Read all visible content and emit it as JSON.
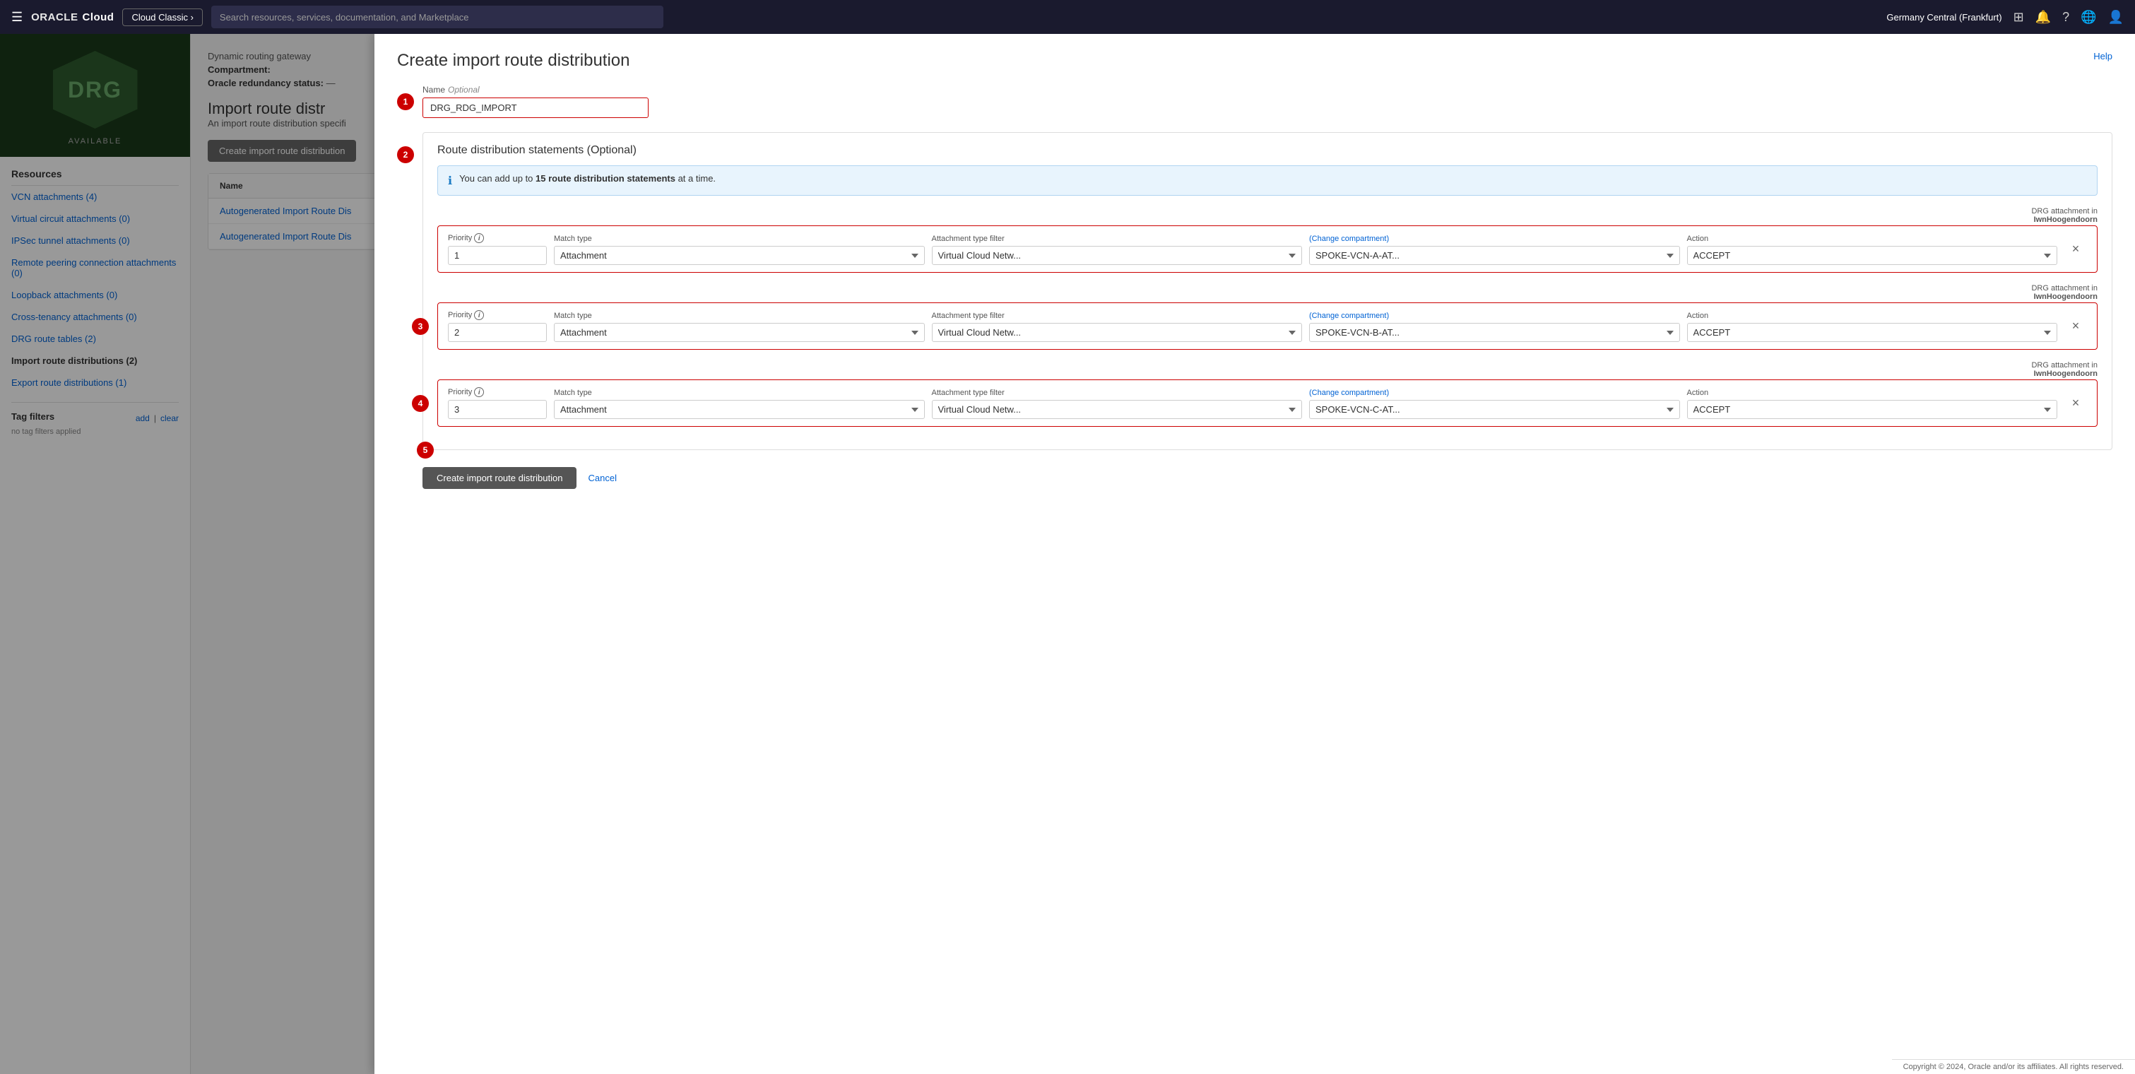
{
  "topNav": {
    "hamburger": "☰",
    "logoOracle": "ORACLE",
    "logoCloud": "Cloud",
    "cloudClassicLabel": "Cloud Classic ›",
    "searchPlaceholder": "Search resources, services, documentation, and Marketplace",
    "region": "Germany Central (Frankfurt)",
    "icons": {
      "console": "⊞",
      "bell": "🔔",
      "help": "?",
      "globe": "🌐",
      "user": "👤"
    }
  },
  "sidebar": {
    "drgText": "DRG",
    "availableLabel": "AVAILABLE",
    "resourcesTitle": "Resources",
    "items": [
      {
        "label": "VCN attachments (4)",
        "active": false
      },
      {
        "label": "Virtual circuit attachments (0)",
        "active": false
      },
      {
        "label": "IPSec tunnel attachments (0)",
        "active": false
      },
      {
        "label": "Remote peering connection attachments (0)",
        "active": false
      },
      {
        "label": "Loopback attachments (0)",
        "active": false
      },
      {
        "label": "Cross-tenancy attachments (0)",
        "active": false
      },
      {
        "label": "DRG route tables (2)",
        "active": false
      },
      {
        "label": "Import route distributions (2)",
        "active": true
      },
      {
        "label": "Export route distributions (1)",
        "active": false
      }
    ],
    "tagFiltersTitle": "Tag filters",
    "tagAddLabel": "add",
    "tagClearLabel": "clear",
    "noTagsLabel": "no tag filters applied"
  },
  "mainContent": {
    "pageHeaderLabel": "Dynamic routing gateway",
    "compartmentLabel": "Compartment:",
    "compartmentValue": "",
    "redundancyLabel": "Oracle redundancy status:",
    "redundancyValue": "—",
    "pageTitlePrefix": "Import route distr",
    "pageSubtitle": "An import route distribution specifi",
    "createBtnLabel": "Create import route distribution"
  },
  "table": {
    "columns": [
      "Name"
    ],
    "rows": [
      {
        "name": "Autogenerated Import Route Dis"
      },
      {
        "name": "Autogenerated Import Route Dis"
      }
    ]
  },
  "modal": {
    "title": "Create import route distribution",
    "helpLabel": "Help",
    "nameLabel": "Name",
    "nameOptional": "Optional",
    "nameValue": "DRG_RDG_IMPORT",
    "namePlaceholder": "",
    "stepNumbers": [
      "1",
      "2",
      "3",
      "4",
      "5"
    ],
    "statementsSection": {
      "title": "Route distribution statements (Optional)",
      "infoBannerText1": "You can add up to ",
      "infoBannerBold": "15 route distribution statements",
      "infoBannerText2": " at a time.",
      "attachmentNote1": "DRG attachment in",
      "attachmentNote2": "IwnHoogendoorn"
    },
    "statements": [
      {
        "priority": "1",
        "matchType": "Attachment",
        "attachmentTypeFilter": "Virtual Cloud Netw...",
        "attachmentFilter": "SPOKE-VCN-A-AT...",
        "action": "ACCEPT"
      },
      {
        "priority": "2",
        "matchType": "Attachment",
        "attachmentTypeFilter": "Virtual Cloud Netw...",
        "attachmentFilter": "SPOKE-VCN-B-AT...",
        "action": "ACCEPT"
      },
      {
        "priority": "3",
        "matchType": "Attachment",
        "attachmentTypeFilter": "Virtual Cloud Netw...",
        "attachmentFilter": "SPOKE-VCN-C-AT...",
        "action": "ACCEPT"
      }
    ],
    "fieldLabels": {
      "priority": "Priority",
      "matchType": "Match type",
      "attachmentTypeFilter": "Attachment type filter",
      "changeCompartment": "(Change compartment)",
      "action": "Action"
    },
    "createBtnLabel": "Create import route distribution",
    "cancelLabel": "Cancel"
  },
  "copyright": "Copyright © 2024, Oracle and/or its affiliates. All rights reserved."
}
